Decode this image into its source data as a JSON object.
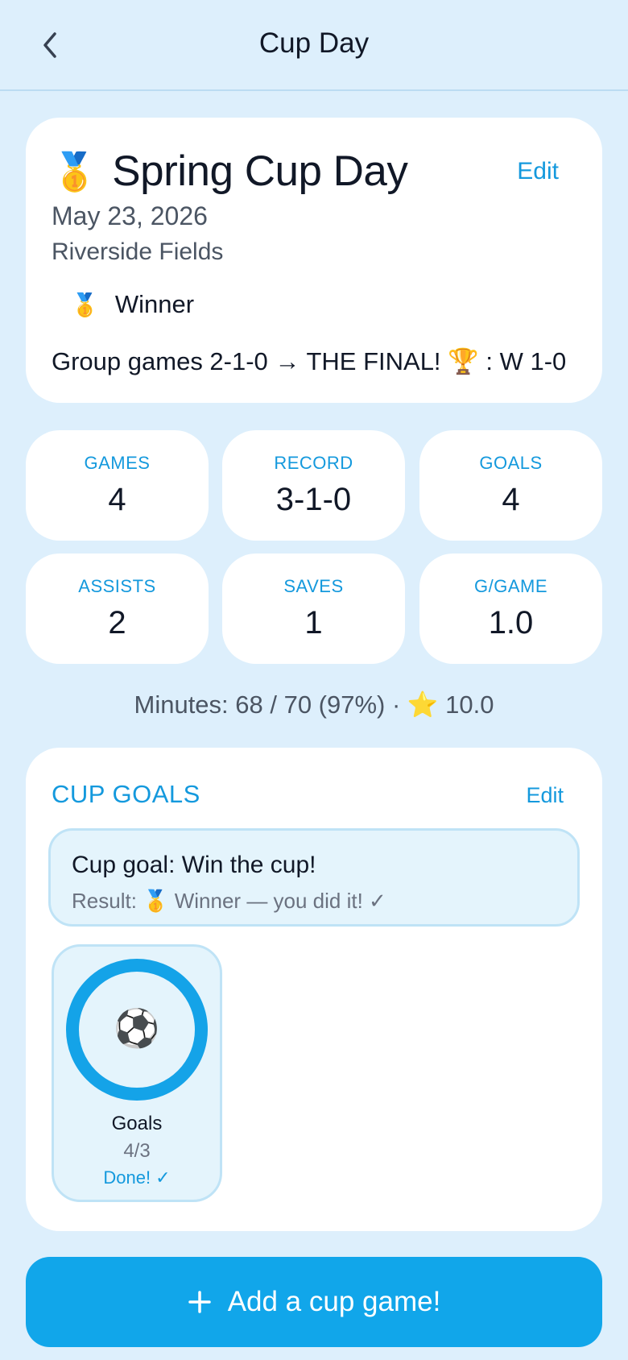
{
  "header": {
    "title": "Cup Day",
    "back_icon": "chevron-left-icon"
  },
  "event": {
    "medal_emoji": "🥇",
    "title": "Spring Cup Day",
    "edit_label": "Edit",
    "date": "May 23, 2026",
    "venue": "Riverside Fields",
    "result_medal": "🥇",
    "result": "Winner",
    "summary": "Group games 2-1-0 → THE FINAL! 🏆 : W 1-0"
  },
  "stats": [
    {
      "label": "GAMES",
      "value": "4"
    },
    {
      "label": "RECORD",
      "value": "3-1-0"
    },
    {
      "label": "GOALS",
      "value": "4"
    },
    {
      "label": "ASSISTS",
      "value": "2"
    },
    {
      "label": "SAVES",
      "value": "1"
    },
    {
      "label": "G/GAME",
      "value": "1.0"
    }
  ],
  "minutes_line": "Minutes: 68 / 70 (97%) · ⭐  10.0",
  "cup_goals": {
    "heading": "CUP GOALS",
    "edit_label": "Edit",
    "goal_text": "Cup goal: Win the cup!",
    "goal_result": "Result: 🥇  Winner — you did it! ✓",
    "progress": {
      "icon": "⚽",
      "label": "Goals",
      "count": "4/3",
      "status": "Done! ✓",
      "fraction": 1.0
    }
  },
  "add_button": {
    "label": "Add a cup game!",
    "icon": "plus-icon"
  },
  "colors": {
    "accent": "#11a6ea",
    "background": "#ddeffc",
    "card": "#ffffff"
  }
}
